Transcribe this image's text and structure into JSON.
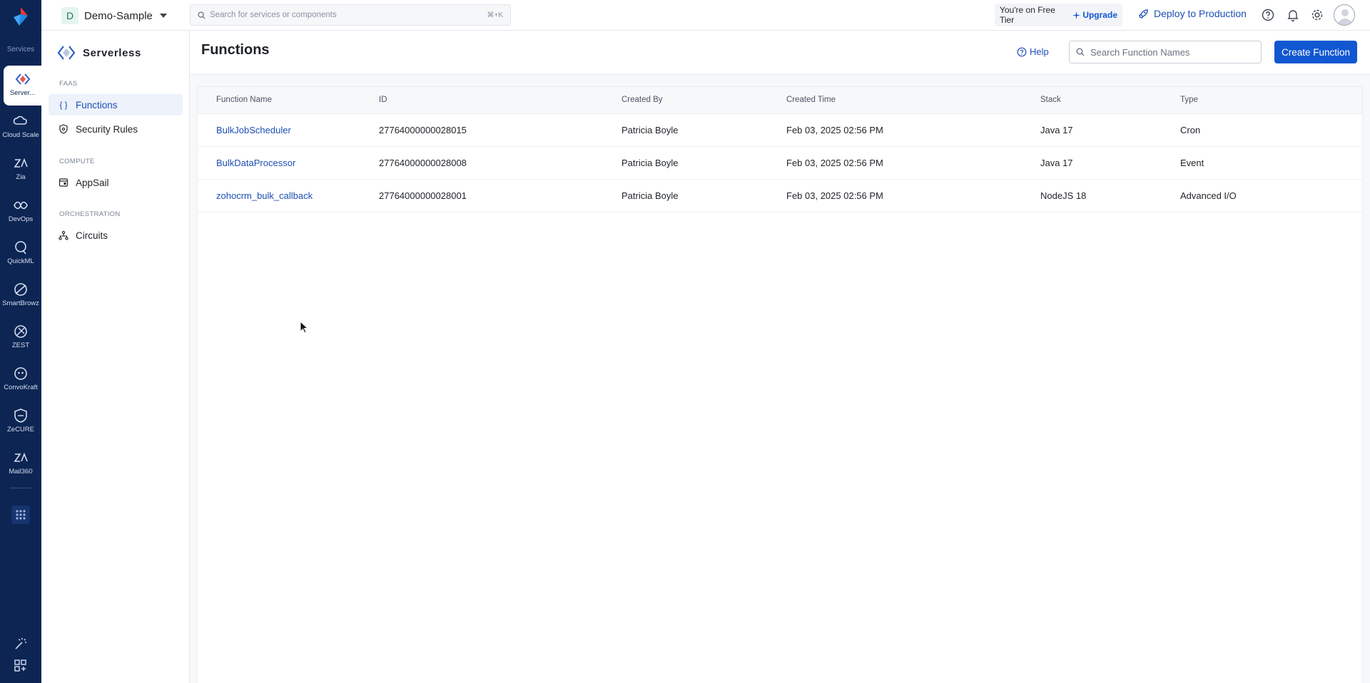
{
  "rail": {
    "services_label": "Services",
    "items": [
      {
        "label": "Server...",
        "icon": "serverless-icon"
      },
      {
        "label": "Cloud Scale",
        "icon": "cloud-scale-icon"
      },
      {
        "label": "Zia",
        "icon": "zia-icon"
      },
      {
        "label": "DevOps",
        "icon": "devops-icon"
      },
      {
        "label": "QuickML",
        "icon": "quickml-icon"
      },
      {
        "label": "SmartBrowz",
        "icon": "smartbrowz-icon"
      },
      {
        "label": "ZEST",
        "icon": "zest-icon"
      },
      {
        "label": "ConvoKraft",
        "icon": "convokraft-icon"
      },
      {
        "label": "ZeCURE",
        "icon": "zecure-icon"
      },
      {
        "label": "Mail360",
        "icon": "mail360-icon"
      }
    ]
  },
  "topbar": {
    "project_initial": "D",
    "project_name": "Demo-Sample",
    "search_placeholder": "Search for services or components",
    "search_shortcut": "⌘+K",
    "tier_text": "You're on Free Tier",
    "upgrade_label": "Upgrade",
    "deploy_label": "Deploy to Production"
  },
  "sidebar": {
    "title": "Serverless",
    "sections": [
      {
        "title": "FAAS",
        "items": [
          {
            "label": "Functions",
            "active": true
          },
          {
            "label": "Security Rules",
            "active": false
          }
        ]
      },
      {
        "title": "COMPUTE",
        "items": [
          {
            "label": "AppSail",
            "active": false
          }
        ]
      },
      {
        "title": "ORCHESTRATION",
        "items": [
          {
            "label": "Circuits",
            "active": false
          }
        ]
      }
    ]
  },
  "main": {
    "title": "Functions",
    "help_label": "Help",
    "search_placeholder": "Search Function Names",
    "create_label": "Create Function",
    "columns": [
      "Function Name",
      "ID",
      "Created By",
      "Created Time",
      "Stack",
      "Type"
    ],
    "rows": [
      [
        "BulkJobScheduler",
        "27764000000028015",
        "Patricia Boyle",
        "Feb 03, 2025 02:56 PM",
        "Java 17",
        "Cron"
      ],
      [
        "BulkDataProcessor",
        "27764000000028008",
        "Patricia Boyle",
        "Feb 03, 2025 02:56 PM",
        "Java 17",
        "Event"
      ],
      [
        "zohocrm_bulk_callback",
        "27764000000028001",
        "Patricia Boyle",
        "Feb 03, 2025 02:56 PM",
        "NodeJS 18",
        "Advanced I/O"
      ]
    ]
  },
  "colors": {
    "rail_bg": "#0c2553",
    "accent": "#1157d1",
    "link": "#1e4fb4"
  }
}
